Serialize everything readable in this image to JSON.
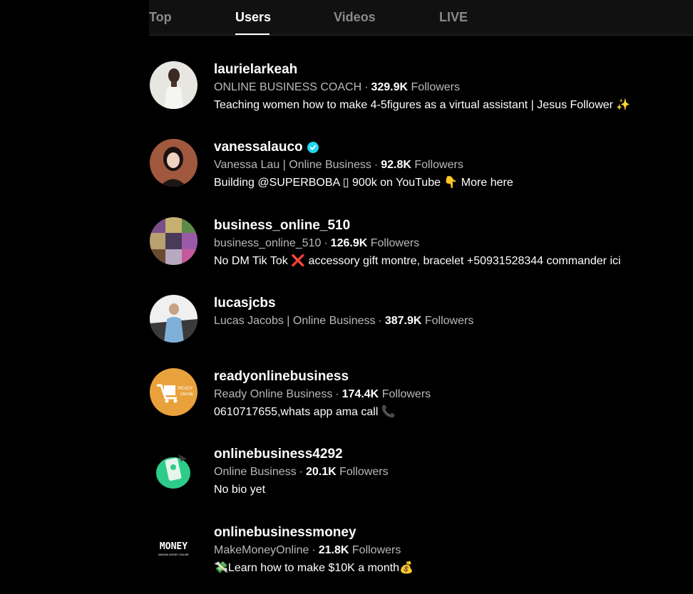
{
  "tabs": [
    {
      "label": "Top",
      "active": false
    },
    {
      "label": "Users",
      "active": true
    },
    {
      "label": "Videos",
      "active": false
    },
    {
      "label": "LIVE",
      "active": false
    }
  ],
  "users": [
    {
      "username": "laurielarkeah",
      "verified": false,
      "display_name": "ONLINE BUSINESS COACH",
      "followers_count": "329.9K",
      "followers_label": "Followers",
      "bio": "Teaching women how to make 4-5figures as a virtual assistant | Jesus Follower ✨"
    },
    {
      "username": "vanessalauco",
      "verified": true,
      "display_name": "Vanessa Lau | Online Business",
      "followers_count": "92.8K",
      "followers_label": "Followers",
      "bio": "Building @SUPERBOBA ▯ 900k on YouTube 👇 More here"
    },
    {
      "username": "business_online_510",
      "verified": false,
      "display_name": "business_online_510",
      "followers_count": "126.9K",
      "followers_label": "Followers",
      "bio": "No DM Tik Tok ❌ accessory gift montre, bracelet +50931528344 commander ici"
    },
    {
      "username": "lucasjcbs",
      "verified": false,
      "display_name": "Lucas Jacobs | Online Business",
      "followers_count": "387.9K",
      "followers_label": "Followers",
      "bio": ""
    },
    {
      "username": "readyonlinebusiness",
      "verified": false,
      "display_name": "Ready Online Business",
      "followers_count": "174.4K",
      "followers_label": "Followers",
      "bio": "0610717655,whats app ama call 📞"
    },
    {
      "username": "onlinebusiness4292",
      "verified": false,
      "display_name": "Online Business",
      "followers_count": "20.1K",
      "followers_label": "Followers",
      "bio": "No bio yet"
    },
    {
      "username": "onlinebusinessmoney",
      "verified": false,
      "display_name": "MakeMoneyOnline",
      "followers_count": "21.8K",
      "followers_label": "Followers",
      "bio": "💸Learn how to make $10K a month💰"
    }
  ],
  "avatar_text": {
    "ready_logo": "READY",
    "ready_logo_sub": "ONLINE",
    "money_logo": "MONEY",
    "money_logo_sub": "MAKING MONEY ONLINE"
  },
  "colors": {
    "background": "#000000",
    "verified_badge": "#20d5ec",
    "muted_text": "#b9b9b9",
    "inactive_tab": "#8a8a8a"
  }
}
